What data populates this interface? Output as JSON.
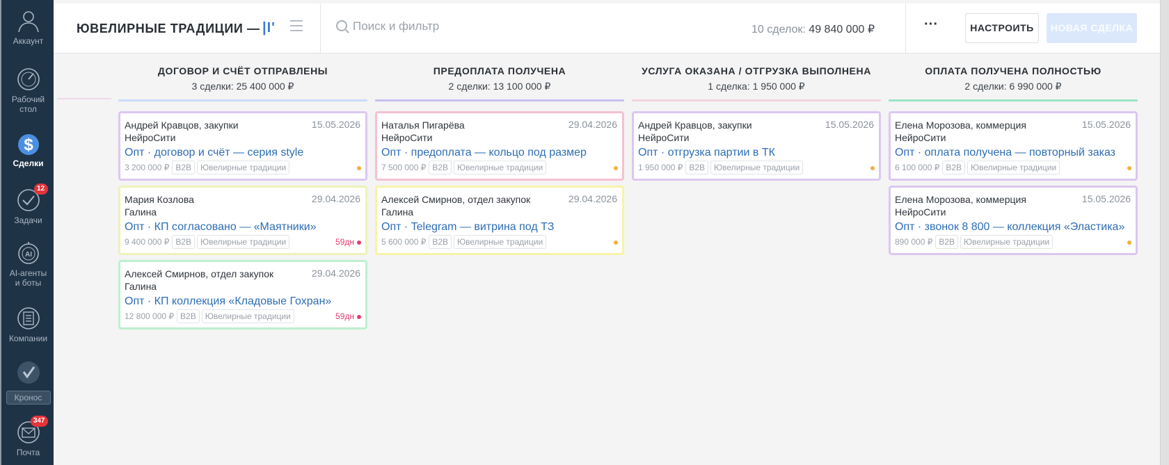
{
  "sidebar": {
    "items": [
      {
        "label": "Аккаунт",
        "icon": "user-icon"
      },
      {
        "label": "Рабочий стол",
        "icon": "dashboard-gauge-icon"
      },
      {
        "label": "Сделки",
        "icon": "deals-dollar-icon",
        "active": true
      },
      {
        "label": "Задачи",
        "icon": "tasks-check-icon",
        "badge": "12"
      },
      {
        "label": "AI-агенты и боты",
        "icon": "ai-bot-icon"
      },
      {
        "label": "Компании",
        "icon": "companies-list-icon"
      },
      {
        "label": "Кронос",
        "icon": "kronos-check-icon"
      },
      {
        "label": "Почта",
        "icon": "mail-icon",
        "badge": "347"
      }
    ]
  },
  "header": {
    "title": "ЮВЕЛИРНЫЕ ТРАДИЦИИ —",
    "kanban_icon_glyph": "|I'",
    "search_placeholder": "Поиск и фильтр",
    "summary_count": "10 сделок:",
    "summary_total": "49 840 000 ₽",
    "more_label": "···",
    "configure_label": "НАСТРОИТЬ",
    "new_deal_label": "НОВАЯ СДЕЛКА"
  },
  "colors": {
    "accent": "#3a7ad8",
    "link": "#2e6db5",
    "overdue": "#e23d6e",
    "dot_orange": "#f0b23c",
    "sidebar_bg": "#1f3346"
  },
  "columns": [
    {
      "title": "ДОГОВОР И СЧЁТ ОТПРАВЛЕНЫ",
      "summary": "3 сделки: 25 400 000 ₽",
      "line_color": "#c9dcfa",
      "cards": [
        {
          "contact": "Андрей Кравцов, закупки",
          "company": "НейроСити",
          "date": "15.05.2026",
          "title": "Опт · договор и счёт — серия style",
          "amount": "3 200 000 ₽",
          "tags": [
            "B2B",
            "Ювелирные традиции"
          ],
          "overdue": "",
          "dot": "#f0b23c",
          "border": "#dcc7f0"
        },
        {
          "contact": "Мария Козлова",
          "company": "Галина",
          "date": "29.04.2026",
          "title": "Опт · КП согласовано — «Маятники»",
          "amount": "9 400 000 ₽",
          "tags": [
            "B2B",
            "Ювелирные традиции"
          ],
          "overdue": "59дн",
          "dot": "#e23d6e",
          "border": "#eef2b8"
        },
        {
          "contact": "Алексей Смирнов, отдел закупок",
          "company": "Галина",
          "date": "29.04.2026",
          "title": "Опт · КП коллекция «Кладовые Гохран»",
          "amount": "12 800 000 ₽",
          "tags": [
            "B2B",
            "Ювелирные традиции"
          ],
          "overdue": "59дн",
          "dot": "#e23d6e",
          "border": "#bdf0d0"
        }
      ]
    },
    {
      "title": "ПРЕДОПЛАТА ПОЛУЧЕНА",
      "summary": "2 сделки: 13 100 000 ₽",
      "line_color": "#c7bff0",
      "cards": [
        {
          "contact": "Наталья Пигарёва",
          "company": "НейроСити",
          "date": "29.04.2026",
          "title": "Опт · предоплата — кольцо под размер",
          "amount": "7 500 000 ₽",
          "tags": [
            "B2B",
            "Ювелирные традиции"
          ],
          "overdue": "",
          "dot": "#f0b23c",
          "border": "#f5c0d2"
        },
        {
          "contact": "Алексей Смирнов, отдел закупок",
          "company": "Галина",
          "date": "29.04.2026",
          "title": "Опт · Telegram — витрина под ТЗ",
          "amount": "5 600 000 ₽",
          "tags": [
            "B2B",
            "Ювелирные традиции"
          ],
          "overdue": "",
          "dot": "#f0b23c",
          "border": "#f6f3a8"
        }
      ]
    },
    {
      "title": "УСЛУГА ОКАЗАНА / ОТГРУЗКА ВЫПОЛНЕНА",
      "summary": "1 сделка: 1 950 000 ₽",
      "line_color": "#f2d3dc",
      "cards": [
        {
          "contact": "Андрей Кравцов, закупки",
          "company": "НейроСити",
          "date": "15.05.2026",
          "title": "Опт · отгрузка партии в ТК",
          "amount": "1 950 000 ₽",
          "tags": [
            "B2B",
            "Ювелирные традиции"
          ],
          "overdue": "",
          "dot": "#f0b23c",
          "border": "#dcc7f0"
        }
      ]
    },
    {
      "title": "ОПЛАТА ПОЛУЧЕНА ПОЛНОСТЬЮ",
      "summary": "2 сделки: 6 990 000 ₽",
      "line_color": "#9be3c6",
      "cards": [
        {
          "contact": "Елена Морозова, коммерция",
          "company": "НейроСити",
          "date": "15.05.2026",
          "title": "Опт · оплата получена — повторный заказ",
          "amount": "6 100 000 ₽",
          "tags": [
            "B2B",
            "Ювелирные традиции"
          ],
          "overdue": "",
          "dot": "#f0b23c",
          "border": "#dcc7f0"
        },
        {
          "contact": "Елена Морозова, коммерция",
          "company": "НейроСити",
          "date": "15.05.2026",
          "title": "Опт · звонок 8 800 — коллекция «Эластика»",
          "amount": "890 000 ₽",
          "tags": [
            "B2B",
            "Ювелирные традиции"
          ],
          "overdue": "",
          "dot": "#f0b23c",
          "border": "#dcc7f0"
        }
      ]
    }
  ]
}
